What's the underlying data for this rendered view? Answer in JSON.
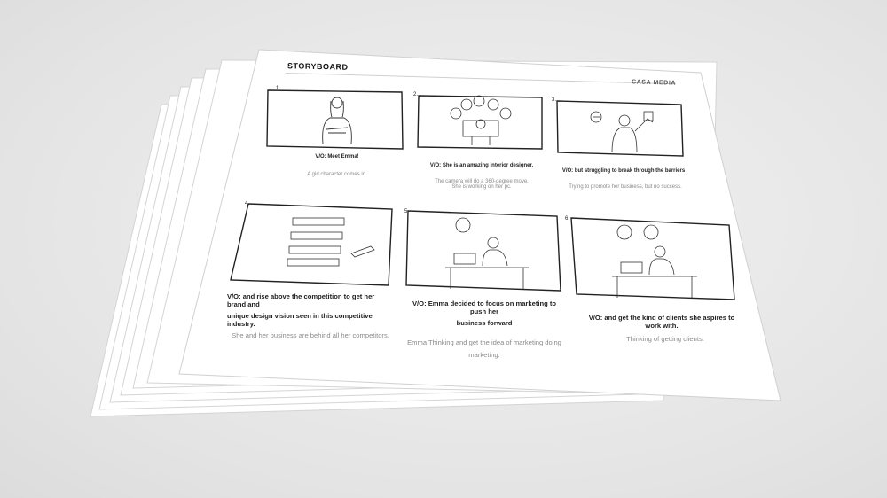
{
  "header": {
    "title": "STORYBOARD",
    "brand": "CASA MEDIA"
  },
  "panels": [
    {
      "number": "1.",
      "vo": "V/O: Meet Emma!",
      "desc": "A girl character comes in."
    },
    {
      "number": "2.",
      "vo": "V/O: She is an amazing interior designer.",
      "desc_lines": [
        "The camera will do a 360-degree move,",
        "She is working on her pc."
      ]
    },
    {
      "number": "3.",
      "vo": "V/O: but struggling to break through the barriers",
      "desc": "Trying to promote her business, but no success."
    },
    {
      "number": "4.",
      "vo_lines": [
        "V/O: and rise above the competition to get her brand and",
        "unique design vision seen in this competitive industry."
      ],
      "desc": "She and her business are behind all her competitors."
    },
    {
      "number": "5.",
      "vo_lines": [
        "V/O: Emma decided to focus on marketing to push her",
        "business forward"
      ],
      "desc_lines": [
        "Emma Thinking and get the idea of marketing doing",
        "marketing."
      ]
    },
    {
      "number": "6.",
      "vo": "V/O: and get the kind of clients she aspires to work with.",
      "desc": "Thinking of getting clients."
    }
  ],
  "colors": {
    "background": "#e6e6e6",
    "paper": "#ffffff",
    "ink": "#222222",
    "muted": "#8a8a8a"
  }
}
